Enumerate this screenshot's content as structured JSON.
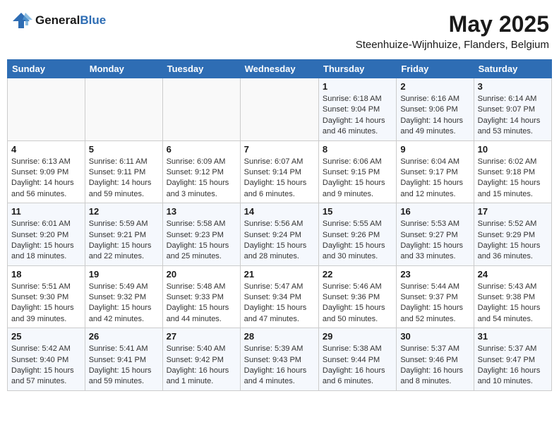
{
  "header": {
    "logo_general": "General",
    "logo_blue": "Blue",
    "title": "May 2025",
    "subtitle": "Steenhuize-Wijnhuize, Flanders, Belgium"
  },
  "days_of_week": [
    "Sunday",
    "Monday",
    "Tuesday",
    "Wednesday",
    "Thursday",
    "Friday",
    "Saturday"
  ],
  "weeks": [
    [
      {
        "day": "",
        "info": ""
      },
      {
        "day": "",
        "info": ""
      },
      {
        "day": "",
        "info": ""
      },
      {
        "day": "",
        "info": ""
      },
      {
        "day": "1",
        "info": "Sunrise: 6:18 AM\nSunset: 9:04 PM\nDaylight: 14 hours\nand 46 minutes."
      },
      {
        "day": "2",
        "info": "Sunrise: 6:16 AM\nSunset: 9:06 PM\nDaylight: 14 hours\nand 49 minutes."
      },
      {
        "day": "3",
        "info": "Sunrise: 6:14 AM\nSunset: 9:07 PM\nDaylight: 14 hours\nand 53 minutes."
      }
    ],
    [
      {
        "day": "4",
        "info": "Sunrise: 6:13 AM\nSunset: 9:09 PM\nDaylight: 14 hours\nand 56 minutes."
      },
      {
        "day": "5",
        "info": "Sunrise: 6:11 AM\nSunset: 9:11 PM\nDaylight: 14 hours\nand 59 minutes."
      },
      {
        "day": "6",
        "info": "Sunrise: 6:09 AM\nSunset: 9:12 PM\nDaylight: 15 hours\nand 3 minutes."
      },
      {
        "day": "7",
        "info": "Sunrise: 6:07 AM\nSunset: 9:14 PM\nDaylight: 15 hours\nand 6 minutes."
      },
      {
        "day": "8",
        "info": "Sunrise: 6:06 AM\nSunset: 9:15 PM\nDaylight: 15 hours\nand 9 minutes."
      },
      {
        "day": "9",
        "info": "Sunrise: 6:04 AM\nSunset: 9:17 PM\nDaylight: 15 hours\nand 12 minutes."
      },
      {
        "day": "10",
        "info": "Sunrise: 6:02 AM\nSunset: 9:18 PM\nDaylight: 15 hours\nand 15 minutes."
      }
    ],
    [
      {
        "day": "11",
        "info": "Sunrise: 6:01 AM\nSunset: 9:20 PM\nDaylight: 15 hours\nand 18 minutes."
      },
      {
        "day": "12",
        "info": "Sunrise: 5:59 AM\nSunset: 9:21 PM\nDaylight: 15 hours\nand 22 minutes."
      },
      {
        "day": "13",
        "info": "Sunrise: 5:58 AM\nSunset: 9:23 PM\nDaylight: 15 hours\nand 25 minutes."
      },
      {
        "day": "14",
        "info": "Sunrise: 5:56 AM\nSunset: 9:24 PM\nDaylight: 15 hours\nand 28 minutes."
      },
      {
        "day": "15",
        "info": "Sunrise: 5:55 AM\nSunset: 9:26 PM\nDaylight: 15 hours\nand 30 minutes."
      },
      {
        "day": "16",
        "info": "Sunrise: 5:53 AM\nSunset: 9:27 PM\nDaylight: 15 hours\nand 33 minutes."
      },
      {
        "day": "17",
        "info": "Sunrise: 5:52 AM\nSunset: 9:29 PM\nDaylight: 15 hours\nand 36 minutes."
      }
    ],
    [
      {
        "day": "18",
        "info": "Sunrise: 5:51 AM\nSunset: 9:30 PM\nDaylight: 15 hours\nand 39 minutes."
      },
      {
        "day": "19",
        "info": "Sunrise: 5:49 AM\nSunset: 9:32 PM\nDaylight: 15 hours\nand 42 minutes."
      },
      {
        "day": "20",
        "info": "Sunrise: 5:48 AM\nSunset: 9:33 PM\nDaylight: 15 hours\nand 44 minutes."
      },
      {
        "day": "21",
        "info": "Sunrise: 5:47 AM\nSunset: 9:34 PM\nDaylight: 15 hours\nand 47 minutes."
      },
      {
        "day": "22",
        "info": "Sunrise: 5:46 AM\nSunset: 9:36 PM\nDaylight: 15 hours\nand 50 minutes."
      },
      {
        "day": "23",
        "info": "Sunrise: 5:44 AM\nSunset: 9:37 PM\nDaylight: 15 hours\nand 52 minutes."
      },
      {
        "day": "24",
        "info": "Sunrise: 5:43 AM\nSunset: 9:38 PM\nDaylight: 15 hours\nand 54 minutes."
      }
    ],
    [
      {
        "day": "25",
        "info": "Sunrise: 5:42 AM\nSunset: 9:40 PM\nDaylight: 15 hours\nand 57 minutes."
      },
      {
        "day": "26",
        "info": "Sunrise: 5:41 AM\nSunset: 9:41 PM\nDaylight: 15 hours\nand 59 minutes."
      },
      {
        "day": "27",
        "info": "Sunrise: 5:40 AM\nSunset: 9:42 PM\nDaylight: 16 hours\nand 1 minute."
      },
      {
        "day": "28",
        "info": "Sunrise: 5:39 AM\nSunset: 9:43 PM\nDaylight: 16 hours\nand 4 minutes."
      },
      {
        "day": "29",
        "info": "Sunrise: 5:38 AM\nSunset: 9:44 PM\nDaylight: 16 hours\nand 6 minutes."
      },
      {
        "day": "30",
        "info": "Sunrise: 5:37 AM\nSunset: 9:46 PM\nDaylight: 16 hours\nand 8 minutes."
      },
      {
        "day": "31",
        "info": "Sunrise: 5:37 AM\nSunset: 9:47 PM\nDaylight: 16 hours\nand 10 minutes."
      }
    ]
  ]
}
